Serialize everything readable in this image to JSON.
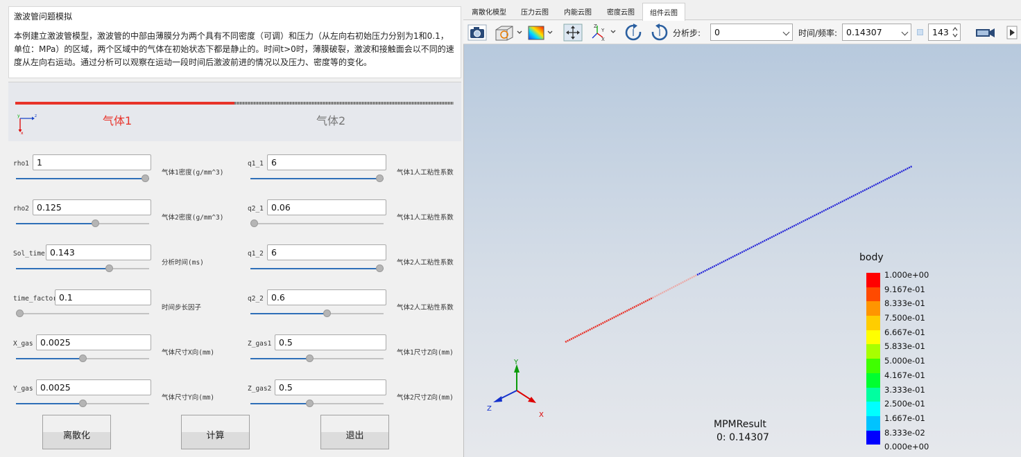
{
  "description": {
    "title": "激波管问题模拟",
    "body": "本例建立激波管模型，激波管的中部由薄膜分为两个具有不同密度（可调）和压力（从左向右初始压力分别为1和0.1，单位：MPa）的区域，两个区域中的气体在初始状态下都是静止的。时间t>0时，薄膜破裂，激波和接触面会以不同的速度从左向右运动。通过分析可以观察在运动一段时间后激波前进的情况以及压力、密度等的变化。"
  },
  "preview": {
    "gas1_label": "气体1",
    "gas2_label": "气体2",
    "axis_y": "y",
    "axis_z": "z",
    "axis_x": "x"
  },
  "params_left": [
    {
      "name": "rho1",
      "value": "1",
      "desc": "气体1密度(g/mm^3)",
      "slider": 1.0
    },
    {
      "name": "rho2",
      "value": "0.125",
      "desc": "气体2密度(g/mm^3)",
      "slider": 0.6
    },
    {
      "name": "Sol_time",
      "value": "0.143",
      "desc": "分析时间(ms)",
      "slider": 0.71
    },
    {
      "name": "time_factor",
      "value": "0.1",
      "desc": "时间步长因子",
      "slider": 0.0
    },
    {
      "name": "X_gas",
      "value": "0.0025",
      "desc": "气体尺寸X向(mm)",
      "slider": 0.5
    },
    {
      "name": "Y_gas",
      "value": "0.0025",
      "desc": "气体尺寸Y向(mm)",
      "slider": 0.5
    }
  ],
  "params_right": [
    {
      "name": "q1_1",
      "value": "6",
      "desc": "气体1人工粘性系数",
      "slider": 1.0
    },
    {
      "name": "q2_1",
      "value": "0.06",
      "desc": "气体1人工粘性系数",
      "slider": 0.0
    },
    {
      "name": "q1_2",
      "value": "6",
      "desc": "气体2人工粘性系数",
      "slider": 1.0
    },
    {
      "name": "q2_2",
      "value": "0.6",
      "desc": "气体2人工粘性系数",
      "slider": 0.58
    },
    {
      "name": "Z_gas1",
      "value": "0.5",
      "desc": "气体1尺寸Z向(mm)",
      "slider": 0.44
    },
    {
      "name": "Z_gas2",
      "value": "0.5",
      "desc": "气体2尺寸Z向(mm)",
      "slider": 0.44
    }
  ],
  "buttons": {
    "discretize": "离散化",
    "compute": "计算",
    "exit": "退出"
  },
  "tabs": [
    {
      "label": "离散化模型",
      "active": false
    },
    {
      "label": "压力云图",
      "active": false
    },
    {
      "label": "内能云图",
      "active": false
    },
    {
      "label": "密度云图",
      "active": false
    },
    {
      "label": "组件云图",
      "active": true
    }
  ],
  "toolbar": {
    "step_label": "分析步:",
    "step_value": "0",
    "time_label": "时间/频率:",
    "time_value": "0.14307",
    "frame_value": "143",
    "icons": [
      "camera-icon",
      "view-cube-icon",
      "color-map-icon",
      "pan-icon",
      "axes-icon",
      "rotate-cw-icon",
      "rotate-ccw-icon",
      "video-camera-icon",
      "next-frame-icon"
    ]
  },
  "viewport": {
    "legend_title": "body",
    "legend_labels": [
      "1.000e+00",
      "9.167e-01",
      "8.333e-01",
      "7.500e-01",
      "6.667e-01",
      "5.833e-01",
      "5.000e-01",
      "4.167e-01",
      "3.333e-01",
      "2.500e-01",
      "1.667e-01",
      "8.333e-02",
      "0.000e+00"
    ],
    "legend_colors": [
      "#ff0000",
      "#ff4a00",
      "#ff9500",
      "#ffcd00",
      "#ffff00",
      "#a8ff00",
      "#3fff00",
      "#00ff30",
      "#00ffa0",
      "#00ffff",
      "#00c3ff",
      "#0067ff",
      "#0000ff"
    ],
    "result_name": "MPMResult",
    "result_time": "0: 0.14307",
    "axis_x": "X",
    "axis_y": "Y",
    "axis_z": "Z"
  },
  "colors": {
    "gas1": "#e8332a",
    "gas2": "#2323d6",
    "accent": "#2e6fb8"
  }
}
